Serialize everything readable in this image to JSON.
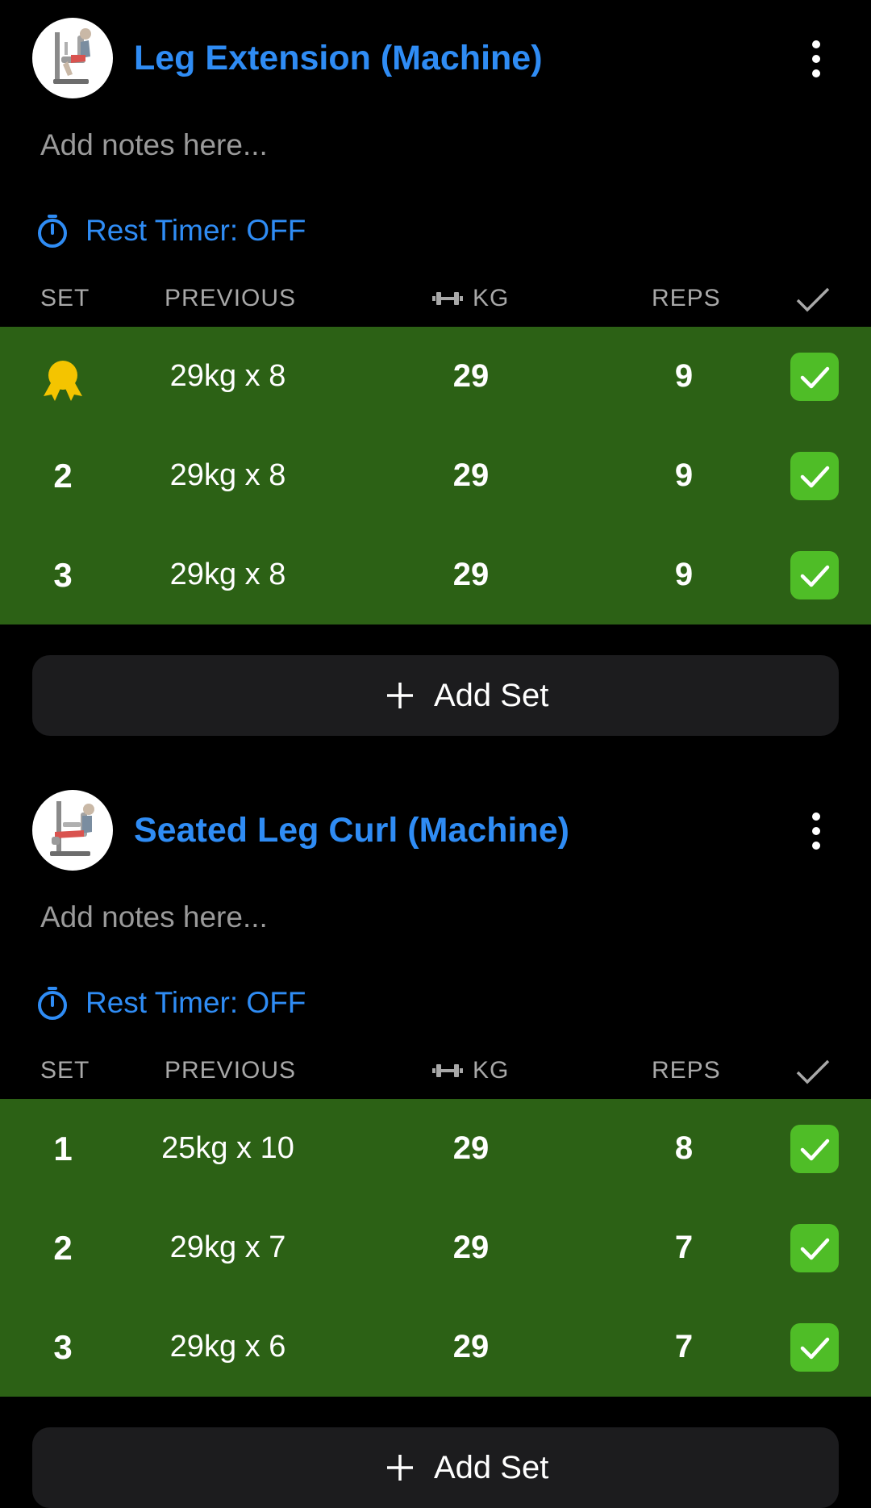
{
  "colors": {
    "accent": "#2f8cf4",
    "row_bg": "#2c6115",
    "check_bg": "#4fbd27",
    "medal": "#f4c400",
    "button_bg": "#1c1c1e"
  },
  "exercises": [
    {
      "title": "Leg Extension (Machine)",
      "thumbnail_icon": "leg-extension-machine-icon",
      "notes_placeholder": "Add notes here...",
      "rest_timer": "Rest Timer: OFF",
      "columns": {
        "set": "SET",
        "previous": "PREVIOUS",
        "kg": "KG",
        "reps": "REPS"
      },
      "sets": [
        {
          "set": "",
          "badge": "medal-icon",
          "previous": "29kg x 8",
          "kg": "29",
          "reps": "9",
          "done": true
        },
        {
          "set": "2",
          "previous": "29kg x 8",
          "kg": "29",
          "reps": "9",
          "done": true
        },
        {
          "set": "3",
          "previous": "29kg x 8",
          "kg": "29",
          "reps": "9",
          "done": true
        }
      ],
      "add_set_label": "Add Set"
    },
    {
      "title": "Seated Leg Curl (Machine)",
      "thumbnail_icon": "seated-leg-curl-machine-icon",
      "notes_placeholder": "Add notes here...",
      "rest_timer": "Rest Timer: OFF",
      "columns": {
        "set": "SET",
        "previous": "PREVIOUS",
        "kg": "KG",
        "reps": "REPS"
      },
      "sets": [
        {
          "set": "1",
          "previous": "25kg x 10",
          "kg": "29",
          "reps": "8",
          "done": true
        },
        {
          "set": "2",
          "previous": "29kg x 7",
          "kg": "29",
          "reps": "7",
          "done": true
        },
        {
          "set": "3",
          "previous": "29kg x 6",
          "kg": "29",
          "reps": "7",
          "done": true
        }
      ],
      "add_set_label": "Add Set"
    }
  ]
}
